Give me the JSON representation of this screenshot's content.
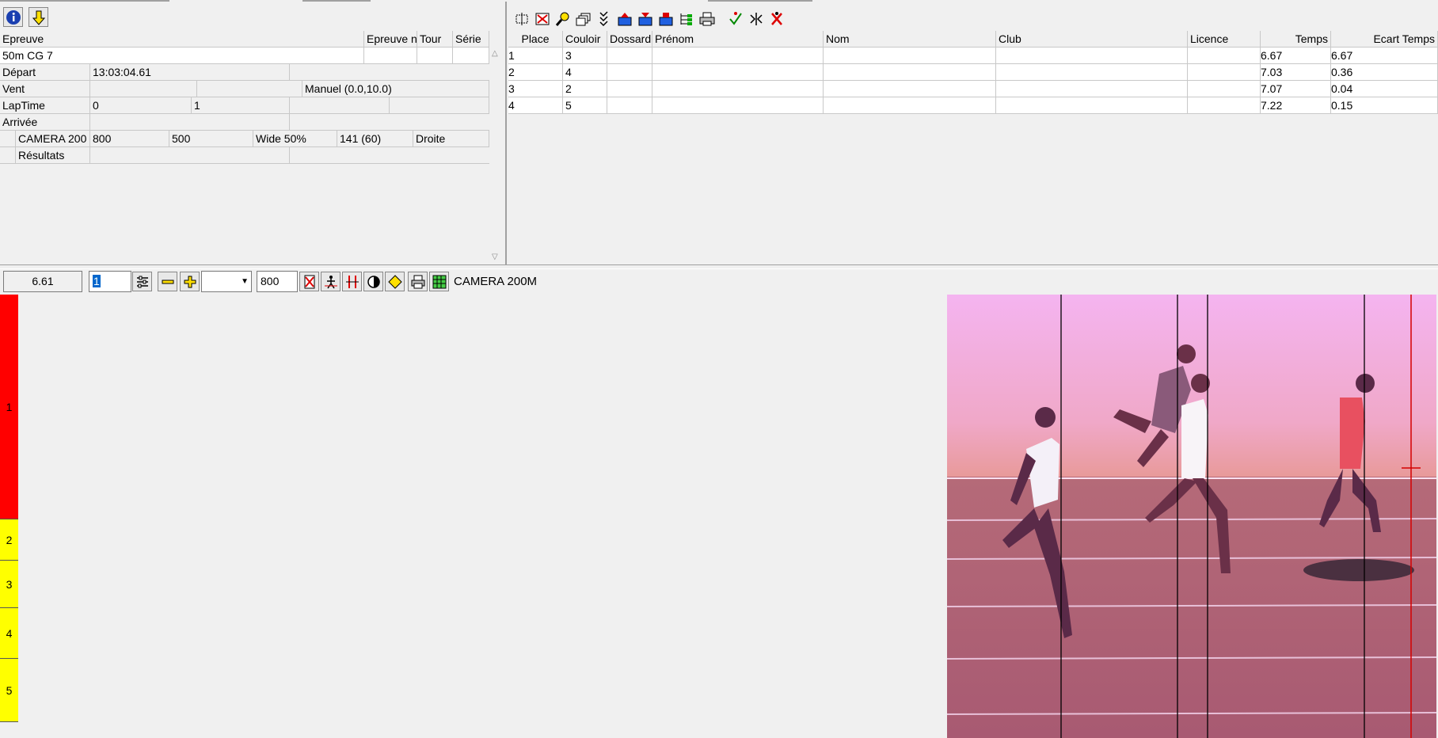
{
  "left_panel": {
    "toolbar": {
      "info_icon": "info-icon",
      "down_arrow_icon": "down-arrow-icon"
    },
    "header": {
      "epreuve": "Epreuve",
      "epreuve_n": "Epreuve n",
      "tour": "Tour",
      "serie": "Série"
    },
    "epreuve_value": "50m CG 7",
    "depart": {
      "label": "Départ",
      "value": "13:03:04.61"
    },
    "vent": {
      "label": "Vent",
      "value": "Manuel (0.0,10.0)"
    },
    "laptime": {
      "label": "LapTime",
      "v1": "0",
      "v2": "1"
    },
    "arrivee": {
      "label": "Arrivée"
    },
    "camera": {
      "name": "CAMERA 200",
      "v1": "800",
      "v2": "500",
      "wide": "Wide 50%",
      "v3": "141  (60)",
      "side": "Droite"
    },
    "resultats": {
      "label": "Résultats"
    }
  },
  "results": {
    "columns": [
      "Place",
      "Couloir",
      "Dossard",
      "Prénom",
      "Nom",
      "Club",
      "Licence",
      "Temps",
      "Ecart Temps"
    ],
    "rows": [
      {
        "place": "1",
        "couloir": "3",
        "temps": "6.67",
        "ecart": "6.67"
      },
      {
        "place": "2",
        "couloir": "4",
        "temps": "7.03",
        "ecart": "0.36"
      },
      {
        "place": "3",
        "couloir": "2",
        "temps": "7.07",
        "ecart": "0.04"
      },
      {
        "place": "4",
        "couloir": "5",
        "temps": "7.22",
        "ecart": "0.15"
      }
    ]
  },
  "bottom_bar": {
    "time": "6.61",
    "lane_input": "1",
    "zoom_select": "",
    "width_value": "800",
    "camera_label": "CAMERA 200M"
  },
  "lanes": [
    "1",
    "2",
    "3",
    "4",
    "5"
  ],
  "colors": {
    "lane1": "#ff0000",
    "lanes_other": "#ffff00",
    "finish_line": "#d40000"
  }
}
